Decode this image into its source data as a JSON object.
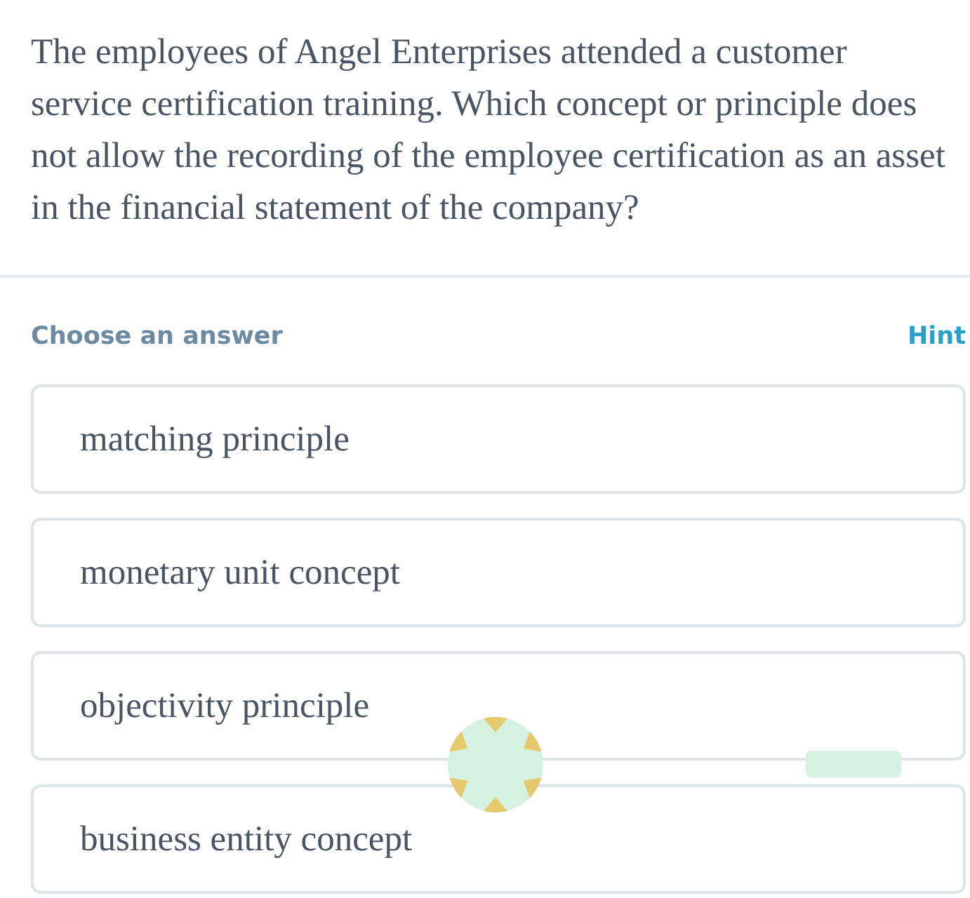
{
  "question": {
    "text": "The employees of Angel Enterprises attended a customer service certification training. Which concept or principle does not allow the recording of the employee certification as an asset in the financial statement of the company?"
  },
  "answer_header": {
    "label": "Choose an answer",
    "hint": "Hint"
  },
  "options": [
    {
      "label": "matching principle",
      "selected": false
    },
    {
      "label": "monetary unit concept",
      "selected": false
    },
    {
      "label": "objectivity principle",
      "selected": false
    },
    {
      "label": "business entity concept",
      "selected": false
    }
  ]
}
